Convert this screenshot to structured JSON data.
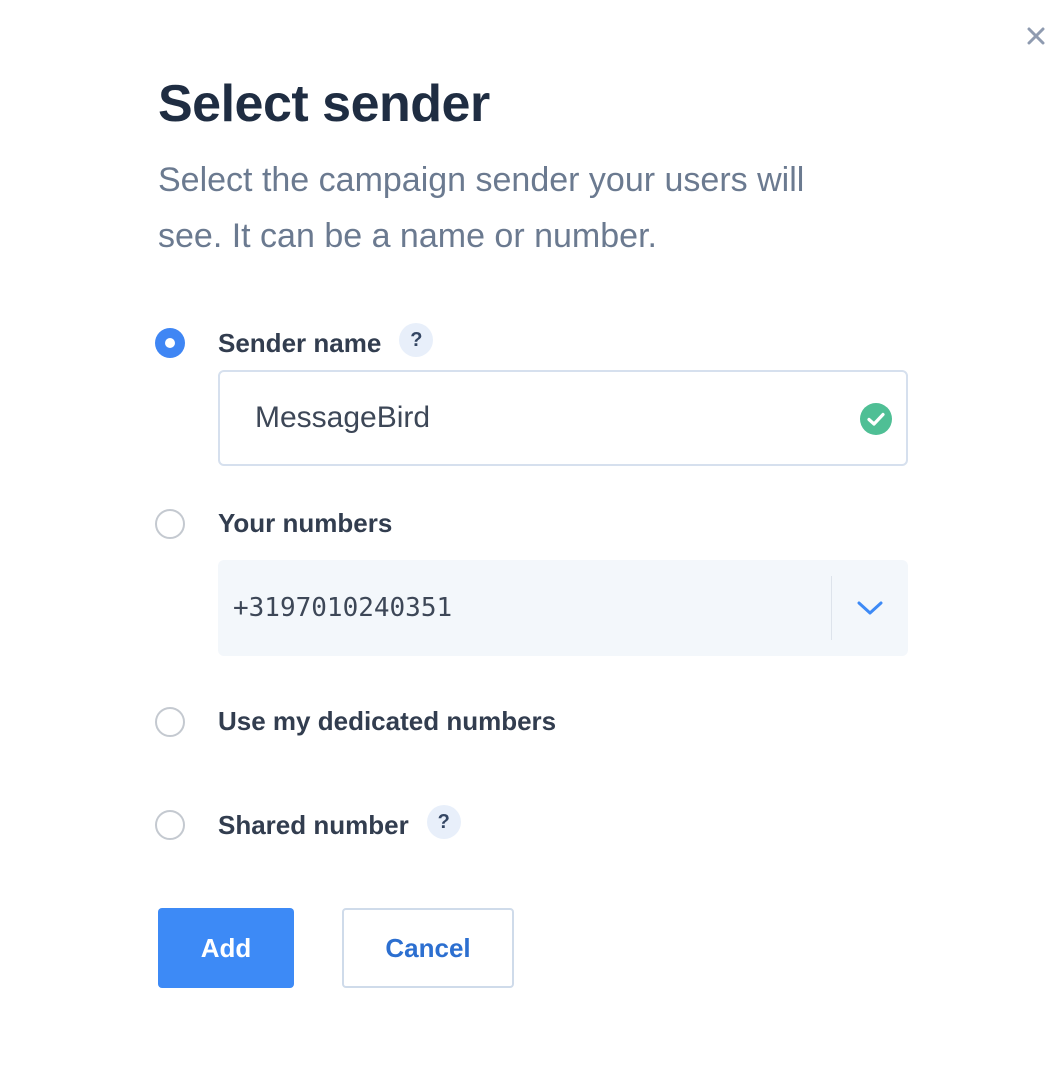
{
  "dialog": {
    "title": "Select sender",
    "subtitle": "Select the campaign sender your users will see. It can be a name or number."
  },
  "options": {
    "sender_name": {
      "label": "Sender name",
      "help": "?",
      "selected": true,
      "value": "MessageBird"
    },
    "your_numbers": {
      "label": "Your numbers",
      "selected": false,
      "value": "+3197010240351"
    },
    "dedicated_numbers": {
      "label": "Use my dedicated numbers",
      "selected": false
    },
    "shared_number": {
      "label": "Shared number",
      "help": "?",
      "selected": false
    }
  },
  "actions": {
    "add_label": "Add",
    "cancel_label": "Cancel"
  },
  "icons": {
    "close": "close-icon",
    "valid": "check-circle-icon",
    "dropdown": "chevron-down-icon"
  },
  "colors": {
    "primary": "#3d8af6",
    "valid": "#4fbf95",
    "title": "#1f2d42",
    "muted": "#6b7a90"
  }
}
